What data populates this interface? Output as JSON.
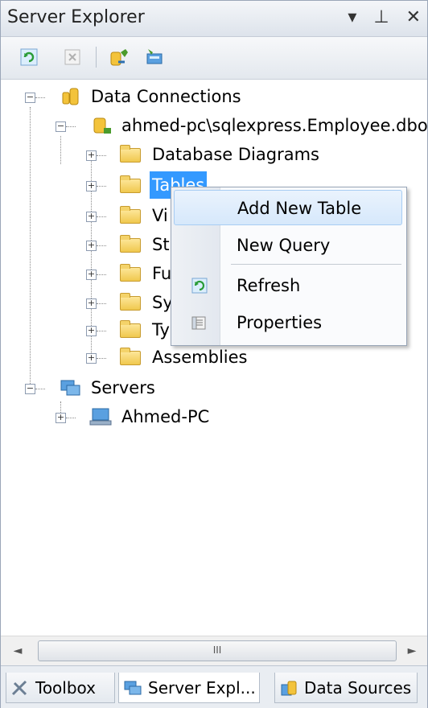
{
  "panel": {
    "title": "Server Explorer",
    "title_buttons": {
      "dropdown": "▾",
      "pin": "⊥",
      "close": "✕"
    }
  },
  "toolbar": {
    "buttons": [
      "refresh-icon",
      "stop-icon",
      "connect-to-database-icon",
      "connect-to-server-icon"
    ]
  },
  "tree": {
    "data_connections": "Data Connections",
    "connection": "ahmed-pc\\sqlexpress.Employee.dbo",
    "folders": [
      "Database Diagrams",
      "Tables",
      "Vi",
      "St",
      "Fu",
      "Sy",
      "Ty",
      "Assemblies"
    ],
    "servers": "Servers",
    "server_item": "Ahmed-PC"
  },
  "context_menu": {
    "items": [
      "Add New Table",
      "New Query",
      "Refresh",
      "Properties"
    ]
  },
  "scrollbar": {
    "left_arrow": "◄",
    "thumb_grip": "III",
    "right_arrow": "►"
  },
  "tabs": [
    "Toolbox",
    "Server Expl...",
    "Data Sources"
  ],
  "colors": {
    "selection": "#3399ff",
    "folder": "#f0c84e",
    "highlight": "#d6e8fb"
  }
}
